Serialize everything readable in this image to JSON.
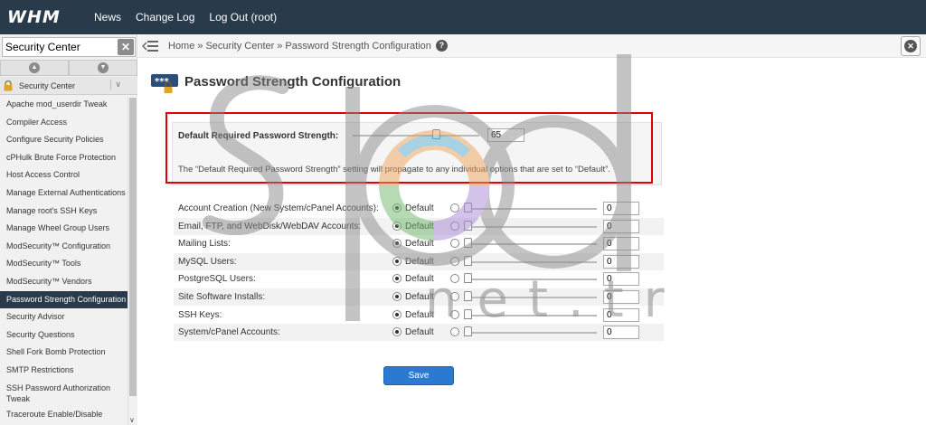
{
  "app": {
    "logo_text": "WHM",
    "nav": [
      {
        "label": "News"
      },
      {
        "label": "Change Log"
      },
      {
        "label": "Log Out (root)"
      }
    ]
  },
  "sidebar": {
    "search_value": "Security Center",
    "clear_icon": "close-icon",
    "category_label": "Security Center",
    "items": [
      {
        "label": "Apache mod_userdir Tweak"
      },
      {
        "label": "Compiler Access"
      },
      {
        "label": "Configure Security Policies"
      },
      {
        "label": "cPHulk Brute Force Protection"
      },
      {
        "label": "Host Access Control"
      },
      {
        "label": "Manage External Authentications"
      },
      {
        "label": "Manage root's SSH Keys"
      },
      {
        "label": "Manage Wheel Group Users"
      },
      {
        "label": "ModSecurity™ Configuration"
      },
      {
        "label": "ModSecurity™ Tools"
      },
      {
        "label": "ModSecurity™ Vendors"
      },
      {
        "label": "Password Strength Configuration",
        "active": true
      },
      {
        "label": "Security Advisor"
      },
      {
        "label": "Security Questions"
      },
      {
        "label": "Shell Fork Bomb Protection"
      },
      {
        "label": "SMTP Restrictions"
      },
      {
        "label": "SSH Password Authorization Tweak",
        "two_line": true
      },
      {
        "label": "Traceroute Enable/Disable"
      }
    ]
  },
  "breadcrumb": {
    "items": [
      "Home",
      "Security Center",
      "Password Strength Configuration"
    ],
    "separator": "»"
  },
  "page": {
    "title": "Password Strength Configuration",
    "icon_text": "***",
    "default_strength": {
      "label": "Default Required Password Strength:",
      "value": "65",
      "note": "The “Default Required Password Strength” setting will propagate to any individual options that are set to “Default”."
    },
    "default_option_label": "Default",
    "rows": [
      {
        "label": "Account Creation (New System/cPanel Accounts):",
        "value": "0"
      },
      {
        "label": "Email, FTP, and WebDisk/WebDAV Accounts:",
        "value": "0"
      },
      {
        "label": "Mailing Lists:",
        "value": "0"
      },
      {
        "label": "MySQL Users:",
        "value": "0"
      },
      {
        "label": "PostgreSQL Users:",
        "value": "0"
      },
      {
        "label": "Site Software Installs:",
        "value": "0"
      },
      {
        "label": "SSH Keys:",
        "value": "0"
      },
      {
        "label": "System/cPanel Accounts:",
        "value": "0"
      }
    ],
    "save_label": "Save"
  },
  "watermark": {
    "line1": "spod",
    "line2": "net.tr"
  },
  "colors": {
    "navbar": "#293a4a",
    "active_item": "#293a4a",
    "save_button": "#2a7ad2",
    "highlight_border": "#e00000"
  }
}
